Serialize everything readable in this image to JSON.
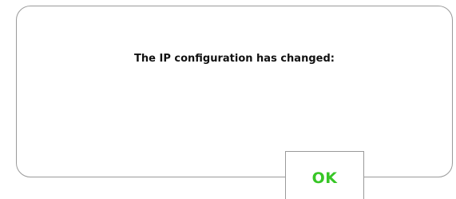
{
  "dialog": {
    "message": "The IP configuration has changed:",
    "ok_label": "OK"
  },
  "colors": {
    "border": "#9a9a9a",
    "message_text": "#111111",
    "ok_text": "#37c626",
    "background": "#ffffff"
  }
}
